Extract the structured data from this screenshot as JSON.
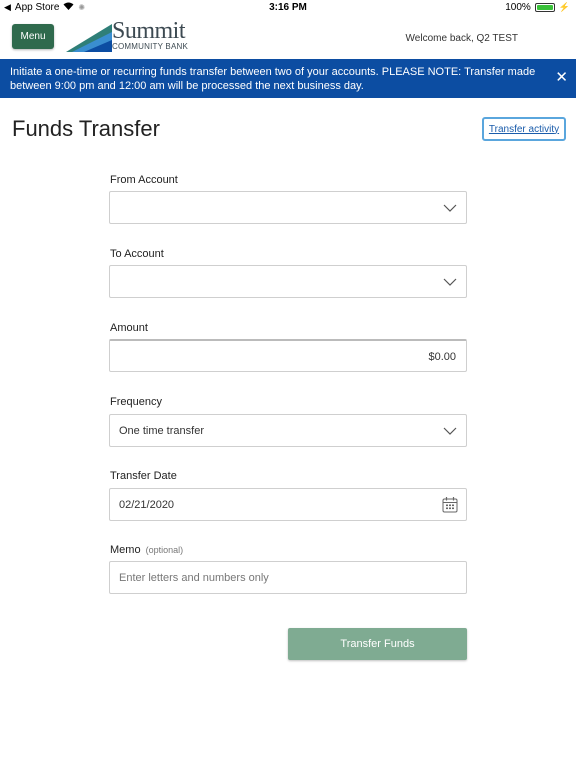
{
  "status_bar": {
    "back_app": "App Store",
    "time": "3:16 PM",
    "battery": "100%",
    "battery_level": 1.0
  },
  "header": {
    "menu_label": "Menu",
    "logo_name": "Summit",
    "logo_sub": "COMMUNITY BANK",
    "welcome": "Welcome back, Q2 TEST"
  },
  "banner": {
    "text": "Initiate a one-time or recurring funds transfer between two of your accounts. PLEASE NOTE: Transfer made between 9:00 pm and 12:00 am will be processed the next business day.",
    "background": "#0c4da2"
  },
  "page": {
    "title": "Funds Transfer",
    "activity_link": "Transfer activity"
  },
  "form": {
    "from_label": "From Account",
    "from_value": "",
    "to_label": "To Account",
    "to_value": "",
    "amount_label": "Amount",
    "amount_value": "$0.00",
    "frequency_label": "Frequency",
    "frequency_value": "One time transfer",
    "date_label": "Transfer Date",
    "date_value": "02/21/2020",
    "memo_label": "Memo",
    "memo_optional": "(optional)",
    "memo_placeholder": "Enter letters and numbers only",
    "submit_label": "Transfer Funds"
  },
  "colors": {
    "menu_button": "#2f6a4d",
    "banner": "#0c4da2",
    "submit_button": "#7fab92",
    "link": "#1a5cab"
  }
}
